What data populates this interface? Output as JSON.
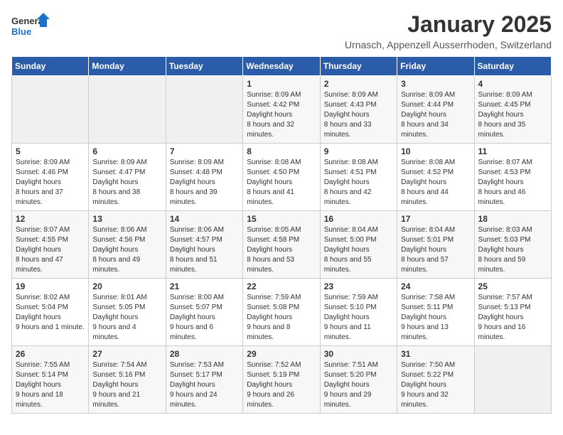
{
  "logo": {
    "general": "General",
    "blue": "Blue"
  },
  "header": {
    "title": "January 2025",
    "subtitle": "Urnasch, Appenzell Ausserrhoden, Switzerland"
  },
  "weekdays": [
    "Sunday",
    "Monday",
    "Tuesday",
    "Wednesday",
    "Thursday",
    "Friday",
    "Saturday"
  ],
  "weeks": [
    [
      {
        "day": "",
        "empty": true
      },
      {
        "day": "",
        "empty": true
      },
      {
        "day": "",
        "empty": true
      },
      {
        "day": "1",
        "sunrise": "8:09 AM",
        "sunset": "4:42 PM",
        "daylight": "8 hours and 32 minutes."
      },
      {
        "day": "2",
        "sunrise": "8:09 AM",
        "sunset": "4:43 PM",
        "daylight": "8 hours and 33 minutes."
      },
      {
        "day": "3",
        "sunrise": "8:09 AM",
        "sunset": "4:44 PM",
        "daylight": "8 hours and 34 minutes."
      },
      {
        "day": "4",
        "sunrise": "8:09 AM",
        "sunset": "4:45 PM",
        "daylight": "8 hours and 35 minutes."
      }
    ],
    [
      {
        "day": "5",
        "sunrise": "8:09 AM",
        "sunset": "4:46 PM",
        "daylight": "8 hours and 37 minutes."
      },
      {
        "day": "6",
        "sunrise": "8:09 AM",
        "sunset": "4:47 PM",
        "daylight": "8 hours and 38 minutes."
      },
      {
        "day": "7",
        "sunrise": "8:09 AM",
        "sunset": "4:48 PM",
        "daylight": "8 hours and 39 minutes."
      },
      {
        "day": "8",
        "sunrise": "8:08 AM",
        "sunset": "4:50 PM",
        "daylight": "8 hours and 41 minutes."
      },
      {
        "day": "9",
        "sunrise": "8:08 AM",
        "sunset": "4:51 PM",
        "daylight": "8 hours and 42 minutes."
      },
      {
        "day": "10",
        "sunrise": "8:08 AM",
        "sunset": "4:52 PM",
        "daylight": "8 hours and 44 minutes."
      },
      {
        "day": "11",
        "sunrise": "8:07 AM",
        "sunset": "4:53 PM",
        "daylight": "8 hours and 46 minutes."
      }
    ],
    [
      {
        "day": "12",
        "sunrise": "8:07 AM",
        "sunset": "4:55 PM",
        "daylight": "8 hours and 47 minutes."
      },
      {
        "day": "13",
        "sunrise": "8:06 AM",
        "sunset": "4:56 PM",
        "daylight": "8 hours and 49 minutes."
      },
      {
        "day": "14",
        "sunrise": "8:06 AM",
        "sunset": "4:57 PM",
        "daylight": "8 hours and 51 minutes."
      },
      {
        "day": "15",
        "sunrise": "8:05 AM",
        "sunset": "4:58 PM",
        "daylight": "8 hours and 53 minutes."
      },
      {
        "day": "16",
        "sunrise": "8:04 AM",
        "sunset": "5:00 PM",
        "daylight": "8 hours and 55 minutes."
      },
      {
        "day": "17",
        "sunrise": "8:04 AM",
        "sunset": "5:01 PM",
        "daylight": "8 hours and 57 minutes."
      },
      {
        "day": "18",
        "sunrise": "8:03 AM",
        "sunset": "5:03 PM",
        "daylight": "8 hours and 59 minutes."
      }
    ],
    [
      {
        "day": "19",
        "sunrise": "8:02 AM",
        "sunset": "5:04 PM",
        "daylight": "9 hours and 1 minute."
      },
      {
        "day": "20",
        "sunrise": "8:01 AM",
        "sunset": "5:05 PM",
        "daylight": "9 hours and 4 minutes."
      },
      {
        "day": "21",
        "sunrise": "8:00 AM",
        "sunset": "5:07 PM",
        "daylight": "9 hours and 6 minutes."
      },
      {
        "day": "22",
        "sunrise": "7:59 AM",
        "sunset": "5:08 PM",
        "daylight": "9 hours and 8 minutes."
      },
      {
        "day": "23",
        "sunrise": "7:59 AM",
        "sunset": "5:10 PM",
        "daylight": "9 hours and 11 minutes."
      },
      {
        "day": "24",
        "sunrise": "7:58 AM",
        "sunset": "5:11 PM",
        "daylight": "9 hours and 13 minutes."
      },
      {
        "day": "25",
        "sunrise": "7:57 AM",
        "sunset": "5:13 PM",
        "daylight": "9 hours and 16 minutes."
      }
    ],
    [
      {
        "day": "26",
        "sunrise": "7:55 AM",
        "sunset": "5:14 PM",
        "daylight": "9 hours and 18 minutes."
      },
      {
        "day": "27",
        "sunrise": "7:54 AM",
        "sunset": "5:16 PM",
        "daylight": "9 hours and 21 minutes."
      },
      {
        "day": "28",
        "sunrise": "7:53 AM",
        "sunset": "5:17 PM",
        "daylight": "9 hours and 24 minutes."
      },
      {
        "day": "29",
        "sunrise": "7:52 AM",
        "sunset": "5:19 PM",
        "daylight": "9 hours and 26 minutes."
      },
      {
        "day": "30",
        "sunrise": "7:51 AM",
        "sunset": "5:20 PM",
        "daylight": "9 hours and 29 minutes."
      },
      {
        "day": "31",
        "sunrise": "7:50 AM",
        "sunset": "5:22 PM",
        "daylight": "9 hours and 32 minutes."
      },
      {
        "day": "",
        "empty": true
      }
    ]
  ],
  "labels": {
    "sunrise": "Sunrise:",
    "sunset": "Sunset:",
    "daylight": "Daylight hours"
  }
}
